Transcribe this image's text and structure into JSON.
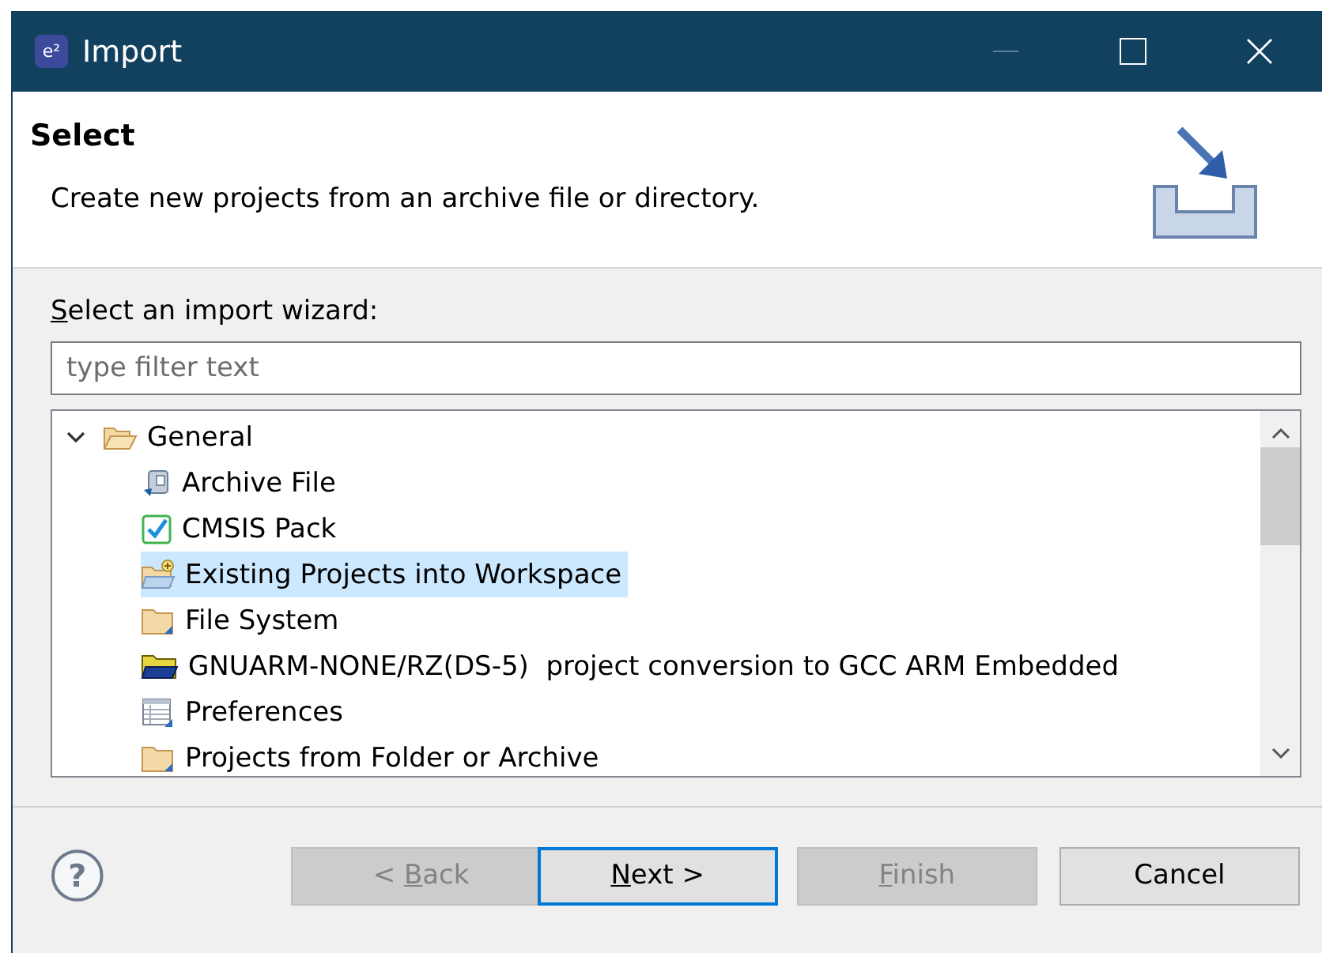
{
  "window": {
    "logo": "e²",
    "title": "Import"
  },
  "header": {
    "title": "Select",
    "description": "Create new projects from an archive file or directory."
  },
  "wizard_label": {
    "mnemonic": "S",
    "rest": "elect an import wizard:"
  },
  "filter": {
    "placeholder": "type filter text"
  },
  "tree": [
    {
      "label": "General",
      "kind": "folder-open",
      "expanded": true,
      "selected": false,
      "children": [
        {
          "label": "Archive File",
          "kind": "archive",
          "selected": false
        },
        {
          "label": "CMSIS Pack",
          "kind": "check",
          "selected": false
        },
        {
          "label": "Existing Projects into Workspace",
          "kind": "folder-plus",
          "selected": true
        },
        {
          "label": "File System",
          "kind": "folder",
          "selected": false
        },
        {
          "label": "GNUARM-NONE/RZ(DS-5)  project conversion to GCC ARM Embedded",
          "kind": "folder-dark",
          "selected": false
        },
        {
          "label": "Preferences",
          "kind": "table",
          "selected": false
        },
        {
          "label": "Projects from Folder or Archive",
          "kind": "folder",
          "selected": false
        }
      ]
    }
  ],
  "buttons": [
    {
      "prefix": "< ",
      "mnemonic": "B",
      "rest": "ack",
      "disabled": true,
      "default": false
    },
    {
      "mnemonic": "N",
      "rest": "ext >",
      "disabled": false,
      "default": true
    },
    {
      "mnemonic": "F",
      "rest": "inish",
      "disabled": true,
      "default": false
    },
    {
      "rest": "Cancel",
      "disabled": false,
      "default": false
    }
  ],
  "help": {
    "glyph": "?"
  }
}
